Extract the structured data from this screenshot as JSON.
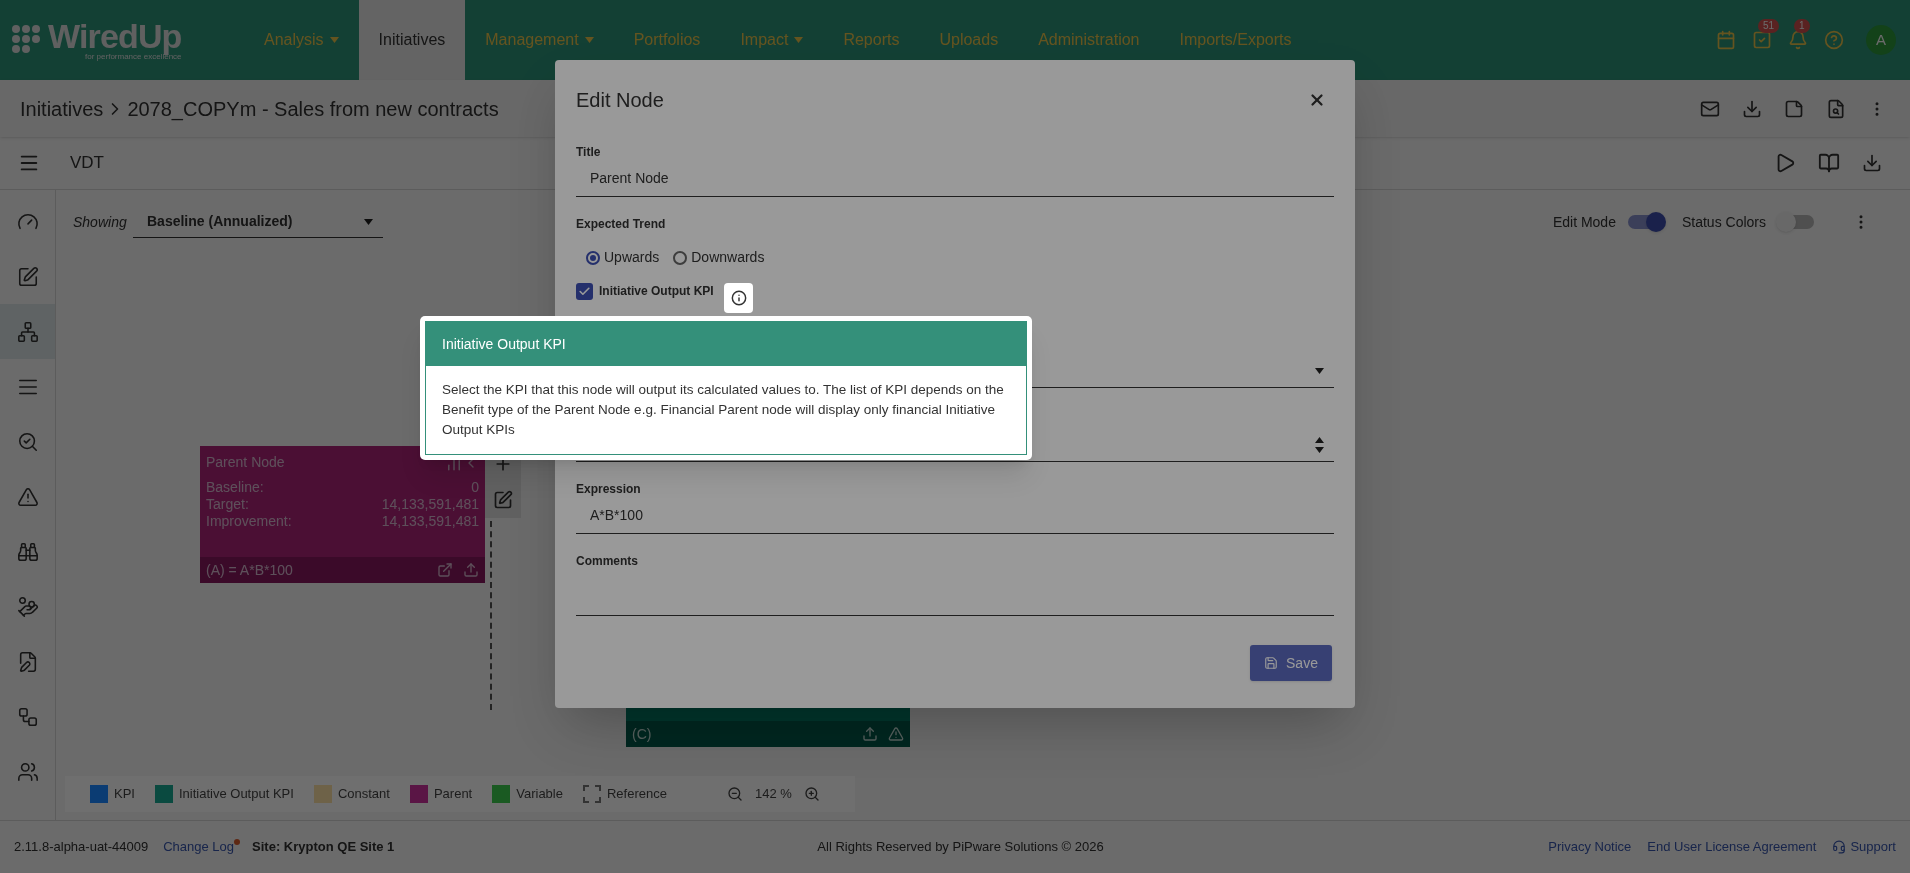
{
  "logo": {
    "name": "WiredUp",
    "tagline": "for performance excellence"
  },
  "nav": [
    {
      "label": "Analysis",
      "dropdown": true,
      "selected": false
    },
    {
      "label": "Initiatives",
      "dropdown": false,
      "selected": true
    },
    {
      "label": "Management",
      "dropdown": true,
      "selected": false
    },
    {
      "label": "Portfolios",
      "dropdown": false,
      "selected": false
    },
    {
      "label": "Impact",
      "dropdown": true,
      "selected": false
    },
    {
      "label": "Reports",
      "dropdown": false,
      "selected": false
    },
    {
      "label": "Uploads",
      "dropdown": false,
      "selected": false
    },
    {
      "label": "Administration",
      "dropdown": false,
      "selected": false
    },
    {
      "label": "Imports/Exports",
      "dropdown": false,
      "selected": false
    }
  ],
  "header_icons": [
    {
      "kind": "calendar"
    },
    {
      "kind": "tasks",
      "badge": "51"
    },
    {
      "kind": "bell",
      "badge": "1"
    },
    {
      "kind": "help"
    }
  ],
  "avatar": "A",
  "breadcrumb": [
    "Initiatives",
    "2078_COPYm - Sales from new contracts"
  ],
  "page_title": "VDT",
  "sidebar": [
    {
      "kind": "gauge",
      "selected": false
    },
    {
      "kind": "edit",
      "selected": false
    },
    {
      "kind": "tree",
      "selected": true
    },
    {
      "kind": "list",
      "selected": false
    },
    {
      "kind": "search",
      "selected": false
    },
    {
      "kind": "warning",
      "selected": false
    },
    {
      "kind": "binoculars",
      "selected": false
    },
    {
      "kind": "hand",
      "selected": false
    },
    {
      "kind": "file",
      "selected": false
    },
    {
      "kind": "network",
      "selected": false
    },
    {
      "kind": "users",
      "selected": false
    }
  ],
  "showing": {
    "label": "Showing",
    "value": "Baseline (Annualized)"
  },
  "toggles": [
    {
      "label": "Edit Mode",
      "on": true
    },
    {
      "label": "Status Colors",
      "on": false
    }
  ],
  "parent_node": {
    "title": "Parent Node",
    "rows": [
      {
        "label": "Baseline:",
        "value": "0"
      },
      {
        "label": "Target:",
        "value": "14,133,591,481"
      },
      {
        "label": "Improvement:",
        "value": "14,133,591,481"
      }
    ],
    "formula": "(A) = A*B*100"
  },
  "node_c": {
    "formula": "(C)"
  },
  "legend": [
    {
      "label": "KPI",
      "kind": "solid",
      "color": "#0b3c73"
    },
    {
      "label": "Initiative Output KPI",
      "kind": "solid",
      "color": "#0a4a40"
    },
    {
      "label": "Constant",
      "kind": "solid",
      "color": "#6e6248"
    },
    {
      "label": "Parent",
      "kind": "solid",
      "color": "#5a1545"
    },
    {
      "label": "Variable",
      "kind": "solid",
      "color": "#1a5a22"
    },
    {
      "label": "Reference",
      "kind": "dashed",
      "color": "#333333"
    }
  ],
  "zoom": "142 %",
  "footer": {
    "version": "2.11.8-alpha-uat-44009",
    "change_log": "Change Log",
    "site": "Site: Krypton QE Site 1",
    "copyright": "All Rights Reserved by PiPware Solutions © 2026",
    "links": [
      "Privacy Notice",
      "End User License Agreement"
    ],
    "support": "Support"
  },
  "dialog": {
    "title": "Edit Node",
    "title_label": "Title",
    "title_value": "Parent Node",
    "trend_label": "Expected Trend",
    "trend_options": [
      {
        "label": "Upwards",
        "selected": true
      },
      {
        "label": "Downwards",
        "selected": false
      }
    ],
    "output_kpi": {
      "label": "Initiative Output KPI",
      "checked": true
    },
    "expression_label": "Expression",
    "expression_value": "A*B*100",
    "comments_label": "Comments",
    "save": "Save"
  },
  "tooltip": {
    "title": "Initiative Output KPI",
    "body": "Select the KPI that this node will output its calculated values to. The list of KPI depends on the Benefit type of the Parent Node e.g. Financial Parent node will display only financial Initiative Output KPIs"
  }
}
